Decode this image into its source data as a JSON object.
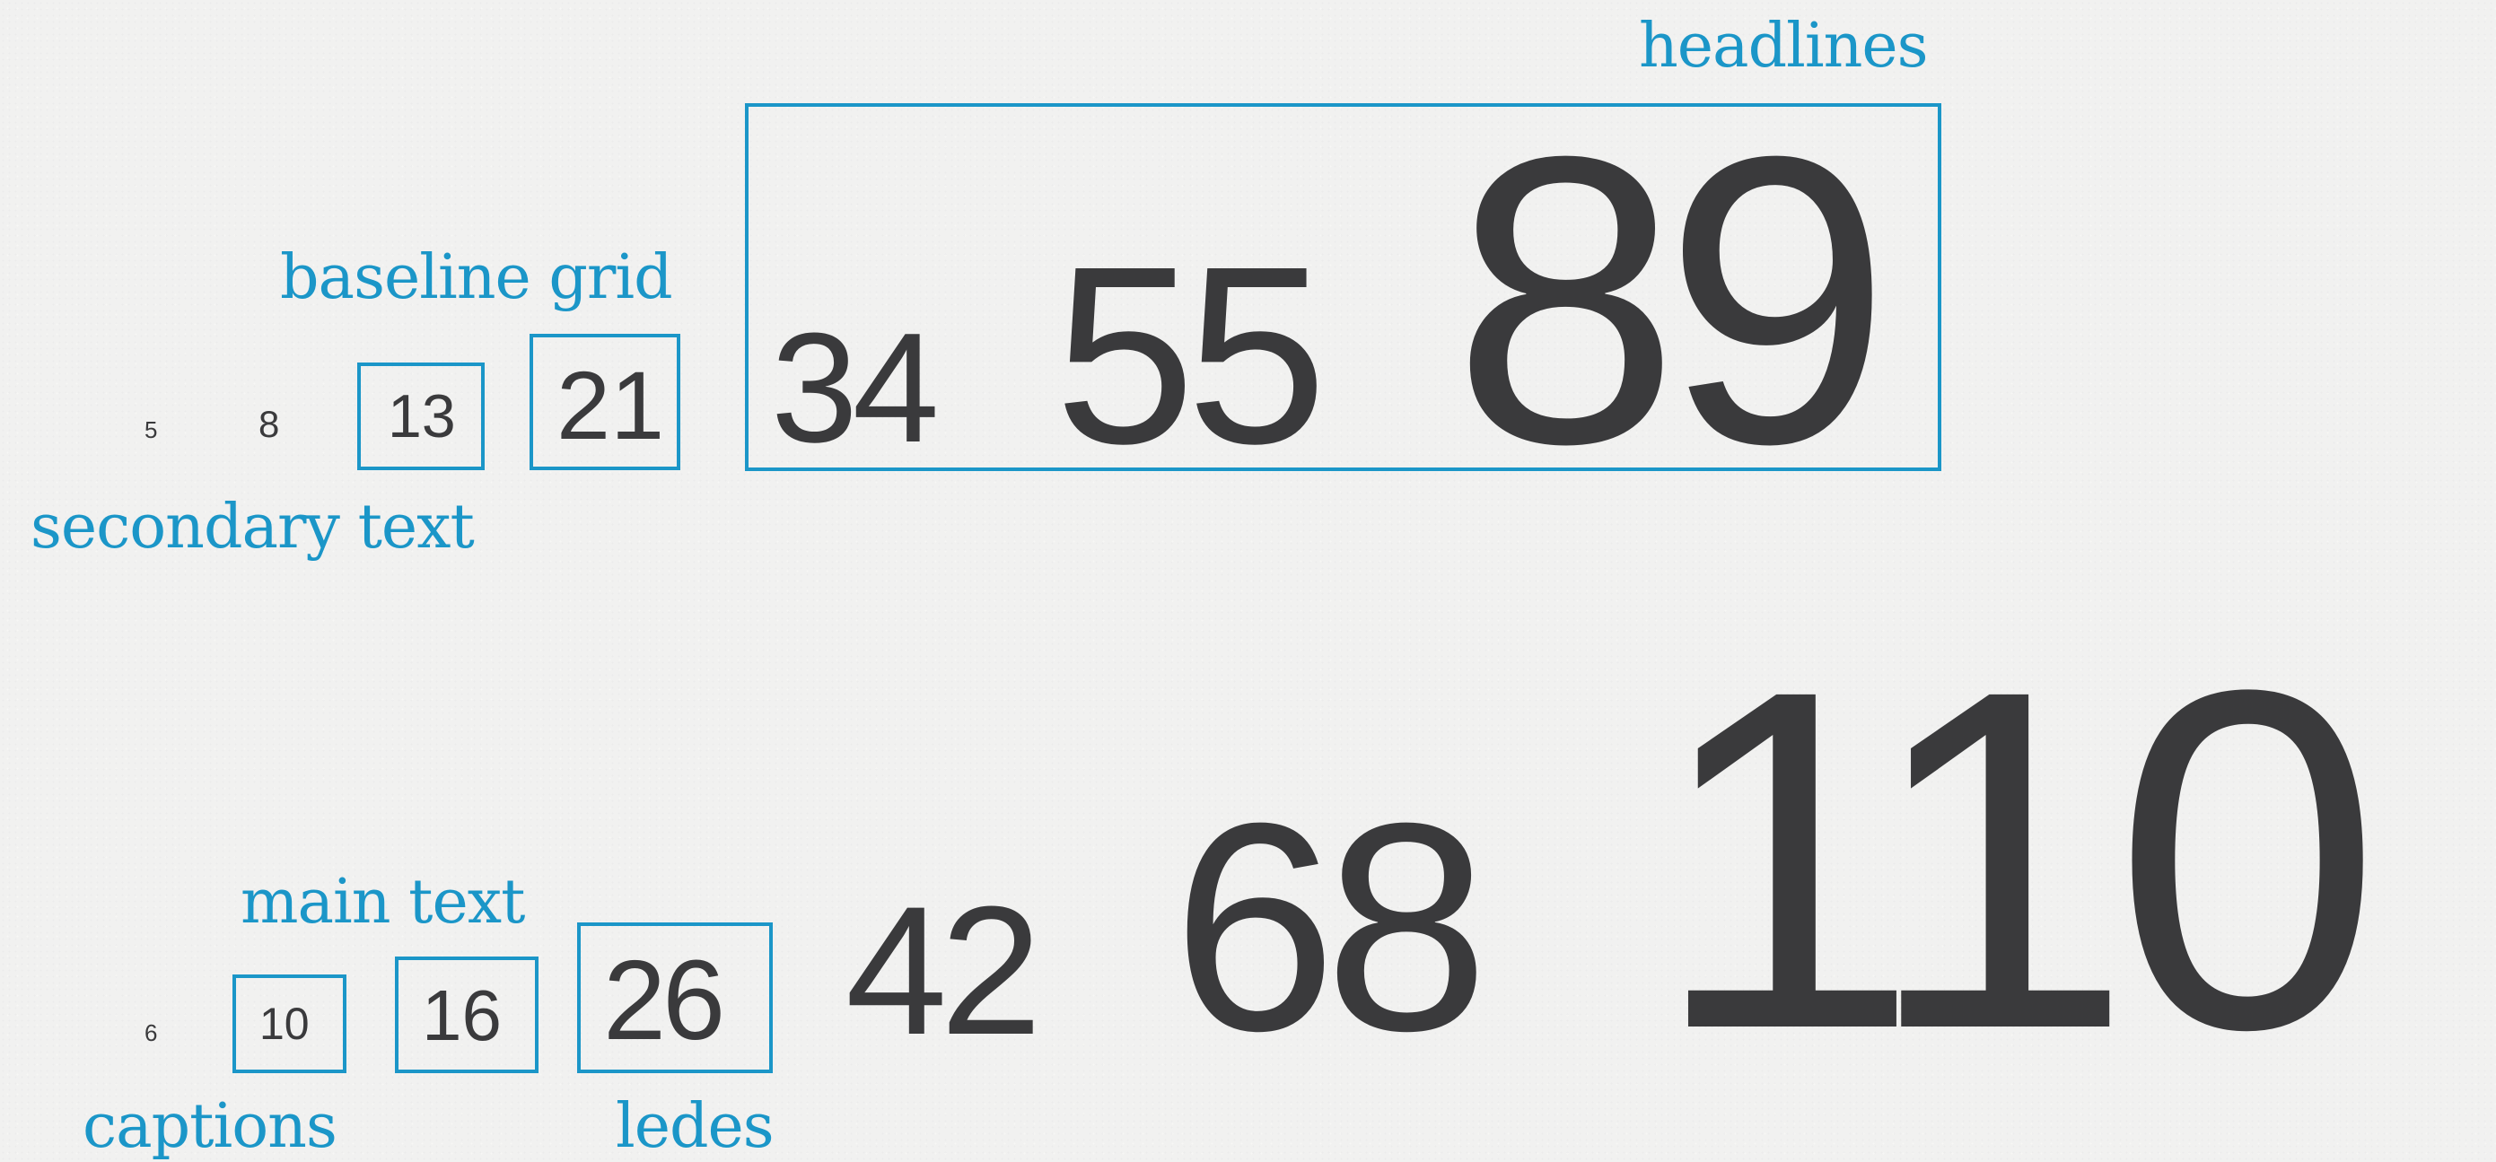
{
  "colors": {
    "background": "#f1f1f0",
    "number_text": "#3a3a3c",
    "accent": "#1b96c8"
  },
  "labels": {
    "headlines": "headlines",
    "baseline_grid": "baseline grid",
    "secondary_text": "secondary text",
    "main_text": "main text",
    "captions": "captions",
    "ledes": "ledes"
  },
  "row1": {
    "n5": "5",
    "n8": "8",
    "n13": "13",
    "n21": "21",
    "n34": "34",
    "n55": "55",
    "n89": "89"
  },
  "row2": {
    "n6": "6",
    "n10": "10",
    "n16": "16",
    "n26": "26",
    "n42": "42",
    "n68": "68",
    "n110": "110"
  }
}
